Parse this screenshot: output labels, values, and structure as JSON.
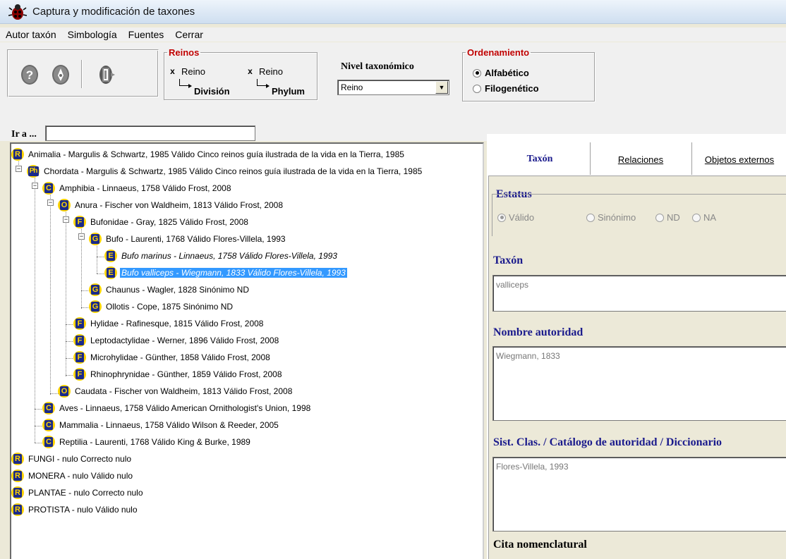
{
  "window": {
    "title": "Captura y modificación de taxones"
  },
  "menu": [
    "Autor taxón",
    "Simbología",
    "Fuentes",
    "Cerrar"
  ],
  "reinos": {
    "legend": "Reinos",
    "check1": {
      "label": "Reino",
      "sub": "División",
      "checked": "x"
    },
    "check2": {
      "label": "Reino",
      "sub": "Phylum",
      "checked": "x"
    }
  },
  "nivel": {
    "label": "Nivel taxonómico",
    "value": "Reino"
  },
  "ordenamiento": {
    "legend": "Ordenamiento",
    "options": [
      "Alfabético",
      "Filogenético"
    ],
    "selected": "Alfabético"
  },
  "ira": {
    "label": "Ir a ...",
    "value": ""
  },
  "tree": [
    {
      "badge": "R",
      "text": "Animalia - Margulis & Schwartz, 1985  Válido  Cinco reinos guía ilustrada de la vida en la Tierra, 1985"
    },
    {
      "badge": "Ph",
      "text": "Chordata - Margulis & Schwartz, 1985  Válido  Cinco reinos guía ilustrada de la vida en la Tierra, 1985"
    },
    {
      "badge": "C",
      "text": "Amphibia - Linnaeus, 1758  Válido  Frost, 2008"
    },
    {
      "badge": "O",
      "text": "Anura - Fischer von Waldheim, 1813  Válido  Frost, 2008"
    },
    {
      "badge": "F",
      "text": "Bufonidae - Gray, 1825  Válido  Frost, 2008"
    },
    {
      "badge": "G",
      "text": "Bufo - Laurenti, 1768  Válido  Flores-Villela, 1993"
    },
    {
      "badge": "E",
      "text": "Bufo marinus - Linnaeus, 1758  Válido  Flores-Villela, 1993"
    },
    {
      "badge": "E",
      "text": "Bufo valliceps - Wiegmann, 1833  Válido  Flores-Villela, 1993"
    },
    {
      "badge": "G",
      "text": "Chaunus - Wagler, 1828  Sinónimo   ND"
    },
    {
      "badge": "G",
      "text": "Ollotis - Cope, 1875  Sinónimo   ND"
    },
    {
      "badge": "F",
      "text": "Hylidae - Rafinesque, 1815  Válido  Frost, 2008"
    },
    {
      "badge": "F",
      "text": "Leptodactylidae - Werner, 1896  Válido  Frost, 2008"
    },
    {
      "badge": "F",
      "text": "Microhylidae - Günther, 1858  Válido  Frost, 2008"
    },
    {
      "badge": "F",
      "text": "Rhinophrynidae - Günther, 1859  Válido  Frost, 2008"
    },
    {
      "badge": "O",
      "text": "Caudata - Fischer von Waldheim, 1813  Válido  Frost, 2008"
    },
    {
      "badge": "C",
      "text": "Aves - Linnaeus, 1758  Válido  American Ornithologist's Union, 1998"
    },
    {
      "badge": "C",
      "text": "Mammalia - Linnaeus, 1758  Válido  Wilson & Reeder, 2005"
    },
    {
      "badge": "C",
      "text": "Reptilia - Laurenti, 1768  Válido  King & Burke, 1989"
    },
    {
      "badge": "R",
      "text": "FUNGI - nulo  Correcto  nulo"
    },
    {
      "badge": "R",
      "text": "MONERA - nulo  Válido  nulo"
    },
    {
      "badge": "R",
      "text": "PLANTAE - nulo  Correcto  nulo"
    },
    {
      "badge": "R",
      "text": "PROTISTA - nulo  Válido  nulo"
    }
  ],
  "tabs": {
    "active": "Taxón",
    "relaciones": "Relaciones",
    "objetos": "Objetos externos"
  },
  "detail": {
    "estatus_label": "Estatus",
    "estatus_options": [
      "Válido",
      "Sinónimo",
      "ND",
      "NA"
    ],
    "estatus_selected": "Válido",
    "taxon_label": "Taxón",
    "taxon_value": "valliceps",
    "autoridad_label": "Nombre autoridad",
    "autoridad_value": "Wiegmann, 1833",
    "sist_label": "Sist. Clas. / Catálogo de autoridad / Diccionario",
    "sist_value": "Flores-Villela, 1993",
    "cita_label": "Cita nomenclatural"
  },
  "colors": {
    "accent_red": "#c00000",
    "accent_blue": "#1a1a8c",
    "selection": "#3399ff",
    "badge_yellow": "#ffd400",
    "badge_navy": "#1a2a8a"
  }
}
